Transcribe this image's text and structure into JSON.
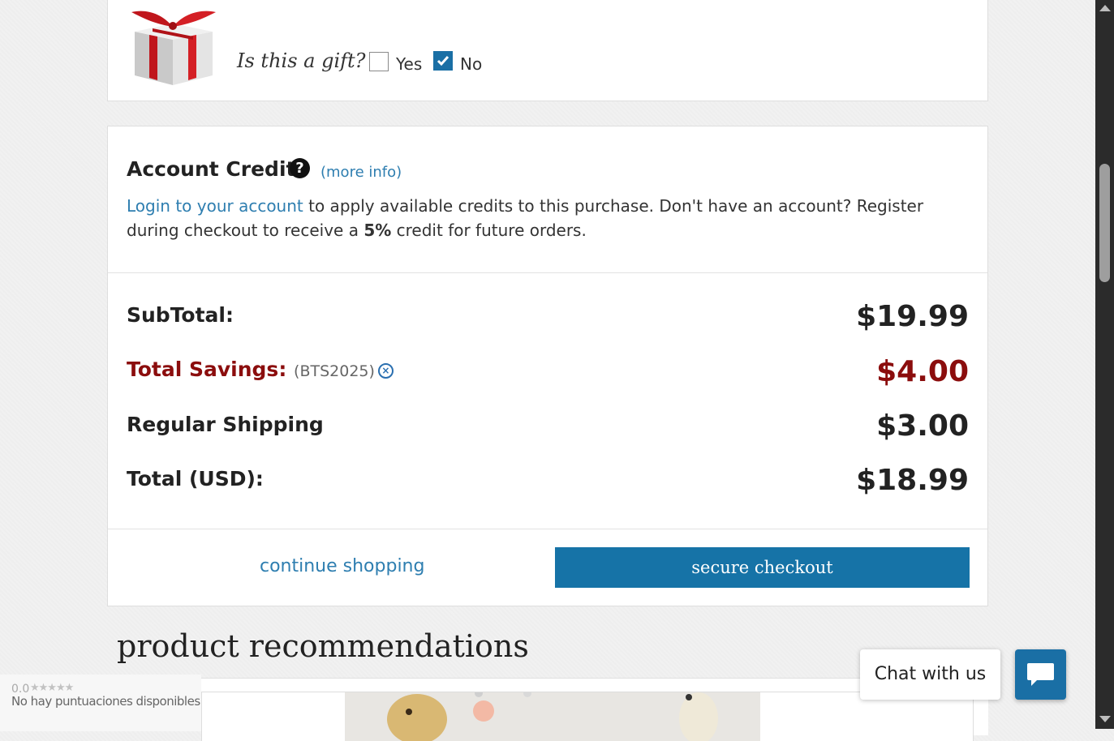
{
  "gift": {
    "question": "Is this a gift?",
    "yes_label": "Yes",
    "no_label": "No",
    "yes_checked": false,
    "no_checked": true
  },
  "credits": {
    "title": "Account Credits",
    "help_glyph": "?",
    "more_info": "(more info)",
    "login_link": "Login to your account",
    "text_part1": " to apply available credits to this purchase. Don't have an account? Register during checkout to receive a ",
    "credit_percent": "5%",
    "text_part2": " credit for future orders."
  },
  "summary": {
    "subtotal_label": "SubTotal:",
    "subtotal_value": "$19.99",
    "savings_label": "Total Savings:",
    "coupon_code": "(BTS2025)",
    "savings_value": "$4.00",
    "shipping_label": "Regular Shipping",
    "shipping_value": "$3.00",
    "total_label": "Total (USD):",
    "total_value": "$18.99"
  },
  "actions": {
    "continue_label": "continue shopping",
    "checkout_label": "secure checkout"
  },
  "recommendations": {
    "title": "product recommendations"
  },
  "rating_widget": {
    "score": "0.0",
    "stars": "★★★★★",
    "text": "No hay puntuaciones disponibles"
  },
  "chat": {
    "label": "Chat with us"
  },
  "colors": {
    "accent": "#1673a7",
    "link": "#2e7eb0",
    "savings": "#8b0d0d"
  }
}
